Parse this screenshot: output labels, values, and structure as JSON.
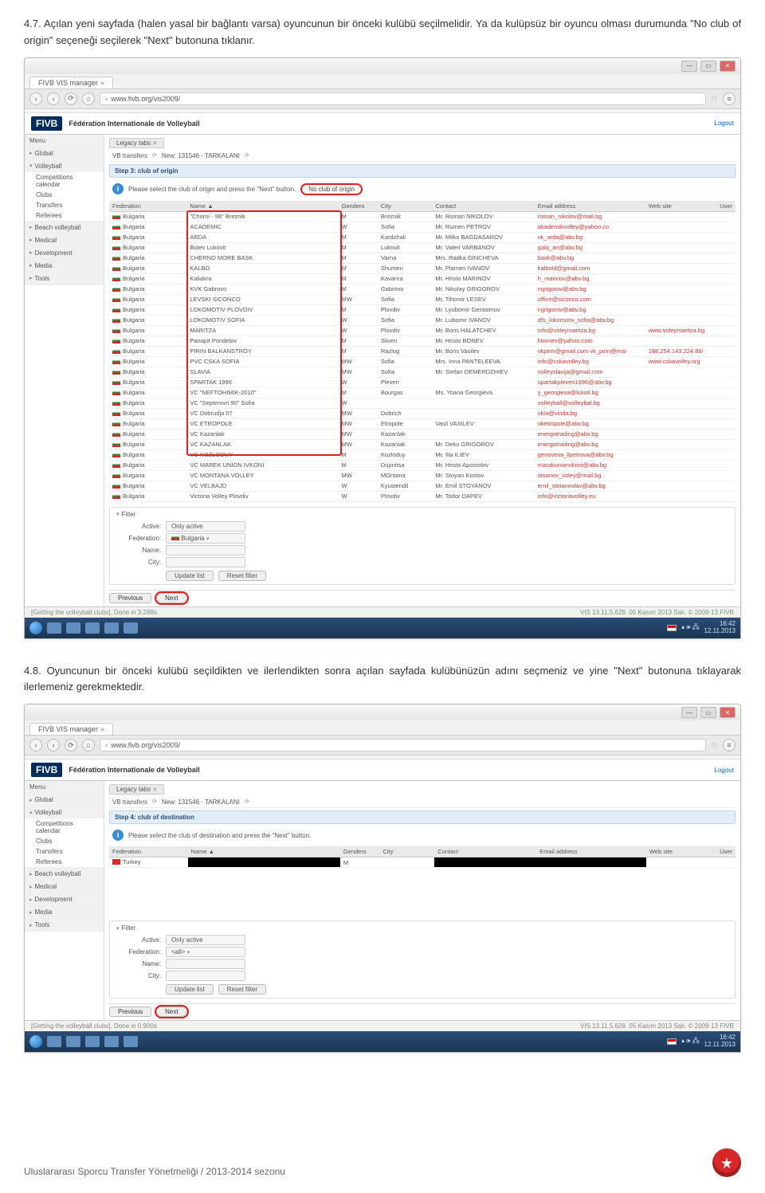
{
  "paragraphs": {
    "p1": "4.7. Açılan yeni sayfada (halen yasal bir bağlantı varsa) oyuncunun bir önceki kulübü seçilmelidir. Ya da kulüpsüz bir oyuncu olması durumunda \"No club of origin\" seçeneği seçilerek \"Next\" butonuna tıklanır.",
    "p2": "4.8. Oyuncunun bir önceki kulübü seçildikten ve ilerlendikten sonra açılan sayfada kulübünüzün adını seçmeniz ve yine \"Next\" butonuna tıklayarak ilerlemeniz gerekmektedir."
  },
  "browser": {
    "tab_title": "FIVB VIS manager",
    "url": "www.fivb.org/vis2009/",
    "bookmarks": ""
  },
  "app": {
    "brand": "FIVB",
    "brand_full": "Fédération Internationale de Volleyball",
    "logout": "Logout",
    "menu_label": "Menu",
    "sidebar": {
      "global": "Global",
      "volleyball": "Volleyball",
      "v_items": [
        "Competitions calendar",
        "Clubs",
        "Transfers",
        "Referees"
      ],
      "beach": "Beach volleyball",
      "medical": "Medical",
      "development": "Development",
      "media": "Media",
      "tools": "Tools"
    },
    "tabs": {
      "legacy": "Legacy tabs"
    },
    "breadcrumb": {
      "a": "VB transfers",
      "b": "New: 131546 - TARKALANI"
    }
  },
  "screen1": {
    "step_title": "Step 3: club of origin",
    "info": "Please select the club of origin and press the \"Next\" button.",
    "no_origin": "No club of origin",
    "columns": [
      "Federation",
      "Name ▲",
      "Genders",
      "City",
      "Contact",
      "Email address",
      "Web site",
      "User"
    ],
    "rows": [
      {
        "fed": "Bulgaria",
        "name": "\"Chorni - 98\" Breznik",
        "g": "M",
        "city": "Breznik",
        "contact": "Mr. Roman NIKOLOV",
        "email": "roman_nikolov@mail.bg"
      },
      {
        "fed": "Bulgaria",
        "name": "ACADEMIC",
        "g": "W",
        "city": "Sofia",
        "contact": "Mr. Rumen PETROV",
        "email": "akademikvolley@yahoo.co"
      },
      {
        "fed": "Bulgaria",
        "name": "ARDA",
        "g": "M",
        "city": "Kardzhali",
        "contact": "Mr. Milko BAGDASAROV",
        "email": "vk_arda@abv.bg"
      },
      {
        "fed": "Bulgaria",
        "name": "Botev Lukovit",
        "g": "M",
        "city": "Lukovit",
        "contact": "Mr. Valeri VARBANOV",
        "email": "galq_an@abv.bg"
      },
      {
        "fed": "Bulgaria",
        "name": "CHERNO MORE BASK",
        "g": "M",
        "city": "Varna",
        "contact": "Mrs. Radka GINCHEVA",
        "email": "bask@abv.bg"
      },
      {
        "fed": "Bulgaria",
        "name": "KALBO",
        "g": "M",
        "city": "Shumen",
        "contact": "Mr. Plamen IVANOV",
        "email": "kalbold@gmail.com"
      },
      {
        "fed": "Bulgaria",
        "name": "Kaliakra",
        "g": "M",
        "city": "Kavarna",
        "contact": "Mr. Hristo MARINOV",
        "email": "h_marinov@abv.bg"
      },
      {
        "fed": "Bulgaria",
        "name": "KVK Gabrovo",
        "g": "M",
        "city": "Gabrovo",
        "contact": "Mr. Nikolay GRIGOROV",
        "email": "ngrigorov@abv.bg"
      },
      {
        "fed": "Bulgaria",
        "name": "LEVSKI SICONCO",
        "g": "MW",
        "city": "Sofia",
        "contact": "Mr. Tihomir LESEV",
        "email": "office@siconco.com"
      },
      {
        "fed": "Bulgaria",
        "name": "LOKOMOTIV PLOVDIV",
        "g": "M",
        "city": "Plovdiv",
        "contact": "Mr. Lyubomir Gerasimov",
        "email": "ngrigorov@abv.bg"
      },
      {
        "fed": "Bulgaria",
        "name": "LOKOMOTIV SOFIA",
        "g": "W",
        "city": "Sofia",
        "contact": "Mr. Lubomir IVANOV",
        "email": "dfs_lokomotiv_sofia@abv.bg"
      },
      {
        "fed": "Bulgaria",
        "name": "MARITZA",
        "g": "W",
        "city": "Plovdiv",
        "contact": "Mr. Boris HALATCHEV",
        "email": "info@voleymaritza.bg",
        "web": "www.voleymaritza.bg"
      },
      {
        "fed": "Bulgaria",
        "name": "Panajot Pondelov",
        "g": "M",
        "city": "Sliven",
        "contact": "Mr. Hristo BONEV",
        "email": "hbonev@yahoo.com"
      },
      {
        "fed": "Bulgaria",
        "name": "PIRIN BALKANSTROY",
        "g": "M",
        "city": "Razlog",
        "contact": "Mr. Boris Vasilev",
        "email": "vkpirin@gmail.com  vk_pirin@mai",
        "web": "188.254.143.224.86/"
      },
      {
        "fed": "Bulgaria",
        "name": "PVC CSKA SOFIA",
        "g": "MW",
        "city": "Sofia",
        "contact": "Mrs. Inna PANTELEEVA",
        "email": "info@cskavolley.bg",
        "web": "www.cskavolley.org"
      },
      {
        "fed": "Bulgaria",
        "name": "SLAVIA",
        "g": "MW",
        "city": "Sofia",
        "contact": "Mr. Stefan DEMERDZHIEV",
        "email": "volleyslavija@gmail.com"
      },
      {
        "fed": "Bulgaria",
        "name": "SPARTAK 1996",
        "g": "W",
        "city": "Pleven",
        "contact": "",
        "email": "spartakpleven1996@abv.bg"
      },
      {
        "fed": "Bulgaria",
        "name": "VC \"NEFTOHIMIK-2010\"",
        "g": "M",
        "city": "Bourgas",
        "contact": "Ms. Yoana Georgieva",
        "email": "y_georgieva@lukoil.bg"
      },
      {
        "fed": "Bulgaria",
        "name": "VC \"Septemvri 90\" Sofia",
        "g": "W",
        "city": "",
        "contact": "",
        "email": "volleyball@volleybal.bg"
      },
      {
        "fed": "Bulgaria",
        "name": "VC Dobrudja 07",
        "g": "MW",
        "city": "Dobrich",
        "contact": "",
        "email": "vkla@vinda.bg"
      },
      {
        "fed": "Bulgaria",
        "name": "VC ETROPOLE",
        "g": "MW",
        "city": "Etropole",
        "contact": "Vasil VASILEV",
        "email": "vketropole@abv.bg"
      },
      {
        "fed": "Bulgaria",
        "name": "VC Kazanlak",
        "g": "MW",
        "city": "Kazanlak",
        "contact": "",
        "email": "energotrading@abv.bg"
      },
      {
        "fed": "Bulgaria",
        "name": "VC KAZANLAK",
        "g": "MW",
        "city": "Kazanlak",
        "contact": "Mr. Deko GRIGOROV",
        "email": "energotrading@abv.bg"
      },
      {
        "fed": "Bulgaria",
        "name": "VC KOZLODUY",
        "g": "M",
        "city": "Kozloduy",
        "contact": "Mr. Ilia ILIEV",
        "email": "genoveva_lipetrova@abv.bg"
      },
      {
        "fed": "Bulgaria",
        "name": "VC MAREK UNION IVKONI",
        "g": "M",
        "city": "Dupnitsa",
        "contact": "Mr. Hristo Apostolov",
        "email": "marakunionvkoni@abv.bg"
      },
      {
        "fed": "Bulgaria",
        "name": "VC MONTANA VOLLEY",
        "g": "MW",
        "city": "MOntana",
        "contact": "Mr. Stoyan Kostov",
        "email": "stoanov_voley@mail.bg"
      },
      {
        "fed": "Bulgaria",
        "name": "VC VELBAJD",
        "g": "W",
        "city": "Kyustendil",
        "contact": "Mr. Emil STOYANOV",
        "email": "emil_stoianovlav@abv.bg"
      },
      {
        "fed": "Bulgaria",
        "name": "Victoria Volley Plovdiv",
        "g": "W",
        "city": "Plovdiv",
        "contact": "Mr. Todor DAPEV",
        "email": "info@victoriavolley.eu"
      }
    ],
    "filter": {
      "head": "Filter",
      "active_label": "Active:",
      "active_value": "Only active",
      "fed_label": "Federation:",
      "fed_value": "Bulgaria",
      "name_label": "Name:",
      "city_label": "City:",
      "update": "Update list",
      "reset": "Reset filter"
    },
    "pager": {
      "prev": "Previous",
      "next": "Next"
    },
    "status_left": "[Getting the volleyball clubs]. Done in 3.288s",
    "status_right": "VIS 13.11.5.628. 05 Kasım 2013 Salı. © 2009-13 FIVB"
  },
  "screen2": {
    "step_title": "Step 4: club of destination",
    "info": "Please select the club of destination and press the \"Next\" button.",
    "columns": [
      "Federation",
      "Name ▲",
      "Genders",
      "City",
      "Contact",
      "Email address",
      "Web site",
      "User"
    ],
    "row": {
      "fed": "Turkey",
      "g": "M"
    },
    "filter": {
      "head": "Filter",
      "active_label": "Active:",
      "active_value": "Only active",
      "fed_label": "Federation:",
      "fed_value": "<all>",
      "name_label": "Name:",
      "city_label": "City:",
      "update": "Update list",
      "reset": "Reset filter"
    },
    "pager": {
      "prev": "Previous",
      "next": "Next"
    },
    "status_left": "[Getting the volleyball clubs]. Done in 0.900s",
    "status_right": "VIS 13.11.5.628. 05 Kasım 2013 Salı. © 2009-13 FIVB"
  },
  "taskbar": {
    "time": "16:42",
    "date": "12.11.2013"
  },
  "footer": "Uluslararası Sporcu Transfer Yönetmeliği / 2013-2014 sezonu"
}
